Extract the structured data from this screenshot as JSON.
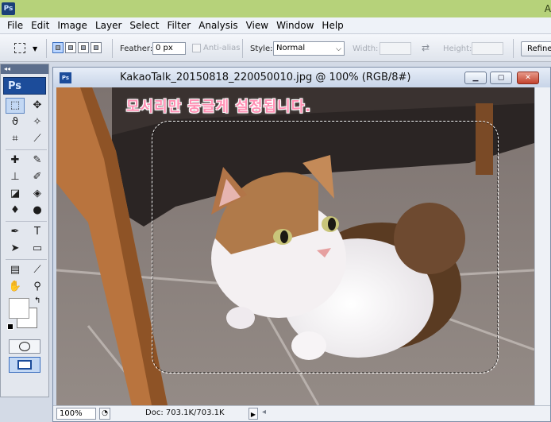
{
  "app": {
    "logo": "Ps",
    "title_fragment": "A"
  },
  "menu": [
    "File",
    "Edit",
    "Image",
    "Layer",
    "Select",
    "Filter",
    "Analysis",
    "View",
    "Window",
    "Help"
  ],
  "options": {
    "feather_label": "Feather:",
    "feather_value": "0 px",
    "antialias_label": "Anti-alias",
    "style_label": "Style:",
    "style_value": "Normal",
    "width_label": "Width:",
    "height_label": "Height:",
    "refine_label": "Refine"
  },
  "tools": {
    "panel_collapse": "◂◂",
    "logo": "Ps"
  },
  "document": {
    "logo": "Ps",
    "title": "KakaoTalk_20150818_220050010.jpg @ 100% (RGB/8#)",
    "caption": "모서리만 둥글게 설정됩니다.",
    "zoom": "100%",
    "doc_size": "Doc: 703.1K/703.1K"
  },
  "colors": {
    "title_strip": "#b6d27a",
    "caption_pink": "#ff8fb3",
    "ps_blue": "#1c4c9a"
  }
}
